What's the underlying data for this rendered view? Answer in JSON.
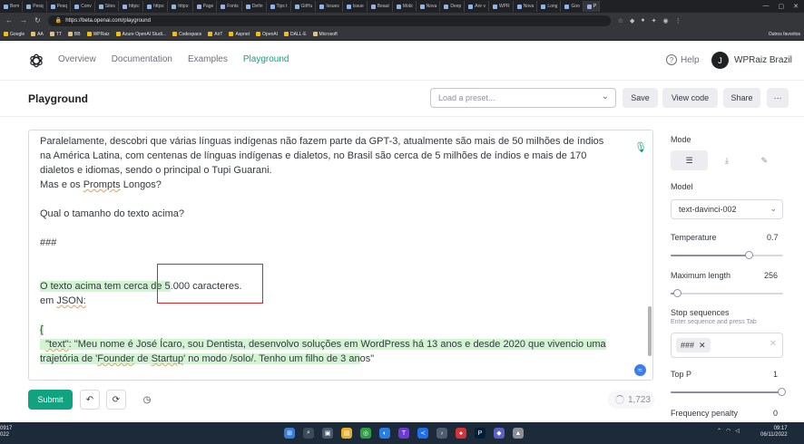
{
  "browser": {
    "tabs": [
      "Bem",
      "Pesq",
      "Pesq",
      "Conv",
      "Sites",
      "https:",
      "https:",
      "https:",
      "Page",
      "Fonts",
      "Defin",
      "Tips t",
      "GitHu",
      "Issues",
      "Issue",
      "Beaut",
      "Mobi",
      "Nova",
      "Deep",
      "Are v",
      "WPR",
      "Nova",
      "Long",
      "Goo",
      "P"
    ],
    "url": "https://beta.openai.com/playground",
    "bookmarks": [
      "Google",
      "AA",
      "TT",
      "BB",
      "WPRaiz",
      "Azure OpenAI Studi...",
      "Codespace",
      "AirT",
      "Aspnet",
      "OpenAI",
      "DALL·E",
      "Microsoft"
    ],
    "bookmarks_other": "Outros favoritos"
  },
  "nav": {
    "links": [
      "Overview",
      "Documentation",
      "Examples",
      "Playground"
    ],
    "help": "Help",
    "account_initial": "J",
    "account_name": "WPRaiz Brazil"
  },
  "header": {
    "title": "Playground",
    "preset_placeholder": "Load a preset...",
    "save": "Save",
    "view_code": "View code",
    "share": "Share",
    "more": "···"
  },
  "editor": {
    "line1": "Paralelamente, descobri que várias línguas indígenas não fazem parte da GPT-3, atualmente são mais de 50 milhões de índios",
    "line2": "na América Latina, com centenas de línguas indígenas e dialetos, no Brasil são cerca de 5 milhões de índios e mais de 170",
    "line3": "dialetos e idiomas, sendo o principal o Tupi Guarani.",
    "line4a": "Mas e os ",
    "line4b": "Prompts",
    "line4c": " Longos?",
    "question": "Qual o tamanho do texto acima?",
    "separator": "###",
    "answer_hl": "O texto acima tem cerca de 5",
    "answer_rest": ".000 caracteres.",
    "json_label_a": "em ",
    "json_label_b": "JSON:",
    "brace": "{",
    "json_line1a": "  ",
    "json_line1b": "\"text\"",
    "json_line1c": ": \"Meu nome é José Ícaro, sou Dentista, desenvolvo soluções em WordPress há 13 anos e desde 2020 que vivencio uma",
    "json_line2a": "trajetória de '",
    "json_line2b": "Founder",
    "json_line2c": " de ",
    "json_line2d": "Startup",
    "json_line2e": "' no modo /solo/. Tenho um filho de 3 an",
    "json_line2f": "os\""
  },
  "footer": {
    "submit": "Submit",
    "token_count": "1,723"
  },
  "sidebar": {
    "mode_label": "Mode",
    "model_label": "Model",
    "model_value": "text-davinci-002",
    "temperature_label": "Temperature",
    "temperature_value": "0.7",
    "max_length_label": "Maximum length",
    "max_length_value": "256",
    "stop_label": "Stop sequences",
    "stop_hint": "Enter sequence and press Tab",
    "stop_chip": "###",
    "top_p_label": "Top P",
    "top_p_value": "1",
    "freq_label": "Frequency penalty",
    "freq_value": "0"
  },
  "taskbar": {
    "left_time": "0917",
    "left_year": "022",
    "clock_time": "09:17",
    "clock_date": "06/11/2022"
  },
  "colors": {
    "accent": "#10a37f",
    "highlight": "#d2f4d3",
    "annotation": "#e02424"
  }
}
